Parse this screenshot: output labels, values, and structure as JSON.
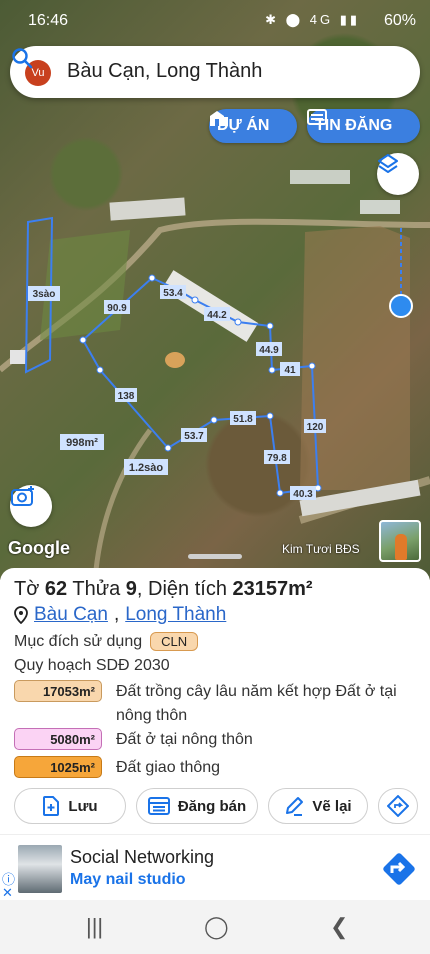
{
  "status": {
    "time": "16:46",
    "network": "4G",
    "battery": "60%"
  },
  "search": {
    "avatar": "Vu",
    "query": "Bàu Cạn, Long Thành"
  },
  "buttons": {
    "du_an": "DỰ ÁN",
    "tin_dang": "TIN ĐĂNG"
  },
  "map": {
    "labels": [
      "3sào",
      "90.9",
      "53.4",
      "44.2",
      "44.9",
      "41",
      "138",
      "120",
      "51.8",
      "53.7",
      "79.8",
      "40.3",
      "998m²",
      "1.2sào"
    ],
    "google": "Google",
    "credit": "Kim Tươi BĐS"
  },
  "parcel": {
    "sheet_label": "Tờ",
    "sheet_no": "62",
    "lot_label": "Thửa",
    "lot_no": "9",
    "area_label": ", Diện tích",
    "area": "23157m²",
    "loc_1": "Bàu Cạn",
    "loc_2": "Long Thành",
    "purpose_label": "Mục đích sử dụng",
    "purpose_code": "CLN",
    "plan": "Quy hoạch SDĐ 2030",
    "zones": [
      {
        "area": "17053m²",
        "desc": "Đất trồng cây lâu năm kết hợp Đất ở tại nông thôn"
      },
      {
        "area": "5080m²",
        "desc": "Đất ở tại nông thôn"
      },
      {
        "area": "1025m²",
        "desc": "Đất giao thông"
      }
    ]
  },
  "actions": {
    "save": "Lưu",
    "sell": "Đăng bán",
    "redraw": "Vẽ lại"
  },
  "ad": {
    "title": "Social Networking",
    "subtitle": "May nail studio"
  },
  "colors": {
    "accent": "#3b7fe0",
    "link": "#2a67c9",
    "boundary": "#3c7ff0"
  },
  "icons": [
    "search-icon",
    "building-icon",
    "list-icon",
    "layers-icon",
    "camera-plus-icon",
    "pin-icon",
    "save-plus-icon",
    "sell-list-icon",
    "edit-icon",
    "directions-icon",
    "info-icon",
    "close-icon",
    "recents-icon",
    "home-icon",
    "back-icon"
  ]
}
